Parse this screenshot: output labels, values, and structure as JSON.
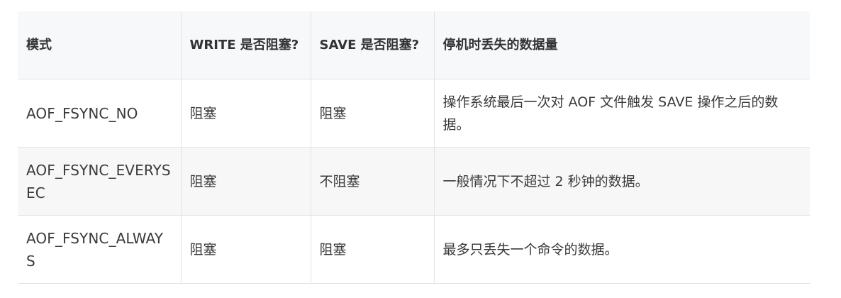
{
  "table": {
    "headers": [
      "模式",
      "WRITE 是否阻塞?",
      "SAVE 是否阻塞?",
      "停机时丢失的数据量"
    ],
    "rows": [
      {
        "mode": "AOF_FSYNC_NO",
        "write": "阻塞",
        "save": "阻塞",
        "loss": "操作系统最后一次对 AOF 文件触发 SAVE 操作之后的数据。"
      },
      {
        "mode": "AOF_FSYNC_EVERYSEC",
        "write": "阻塞",
        "save": "不阻塞",
        "loss": "一般情况下不超过 2 秒钟的数据。"
      },
      {
        "mode": "AOF_FSYNC_ALWAYS",
        "write": "阻塞",
        "save": "阻塞",
        "loss": "最多只丢失一个命令的数据。"
      }
    ]
  }
}
